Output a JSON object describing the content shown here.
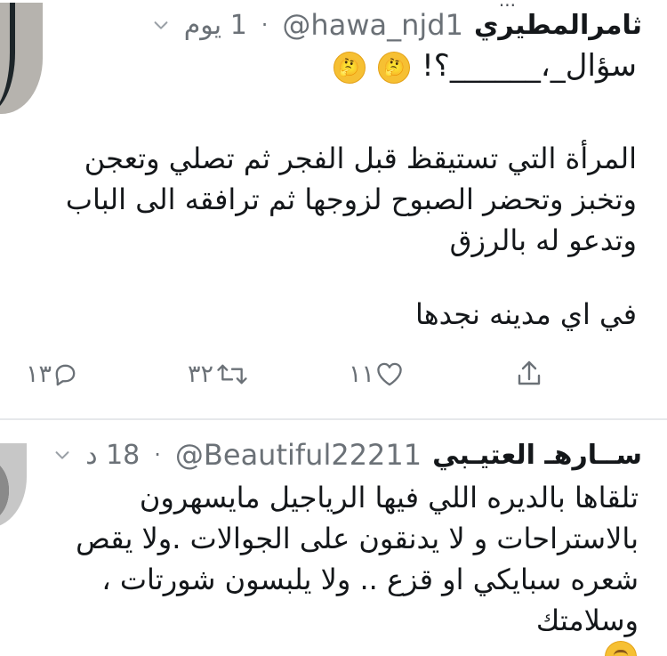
{
  "top_cut_text": "...",
  "tweets": [
    {
      "name": "ثامرالمطيري",
      "handle": "@hawa_njd1",
      "time": "1 يوم",
      "dot": "·",
      "question": "سؤال_،______؟!",
      "question_emojis": [
        "thinking-face-emoji",
        "thinking-face-emoji"
      ],
      "body_lines": [
        "المرأة التي تستيقظ قبل الفجر ثم تصلي وتعجن",
        "وتخبز وتحضر الصبوح لزوجها ثم ترافقه الى الباب",
        "وتدعو له بالرزق"
      ],
      "closing": "في اي مدينه نجدها",
      "counts": {
        "reply": "١٣",
        "retweet": "٣٢",
        "like": "١١"
      }
    },
    {
      "name": "ســارهـ العتيـبي",
      "handle": "@Beautiful22211",
      "time": "18 د",
      "dot": "·",
      "body_lines": [
        "تلقاها بالديره اللي فيها الرياجيل مايسهرون",
        "بالاستراحات و لا يدنقون على الجوالات .ولا يقص",
        "شعره سبايكي او قزع .. ولا يلبسون شورتات ،",
        "وسلامتك"
      ],
      "emoji": "smiling-face-emoji"
    }
  ],
  "colors": {
    "text": "#14171a",
    "muted": "#6b7177",
    "divider": "#e6e8eb",
    "emoji": "#f6c033"
  }
}
